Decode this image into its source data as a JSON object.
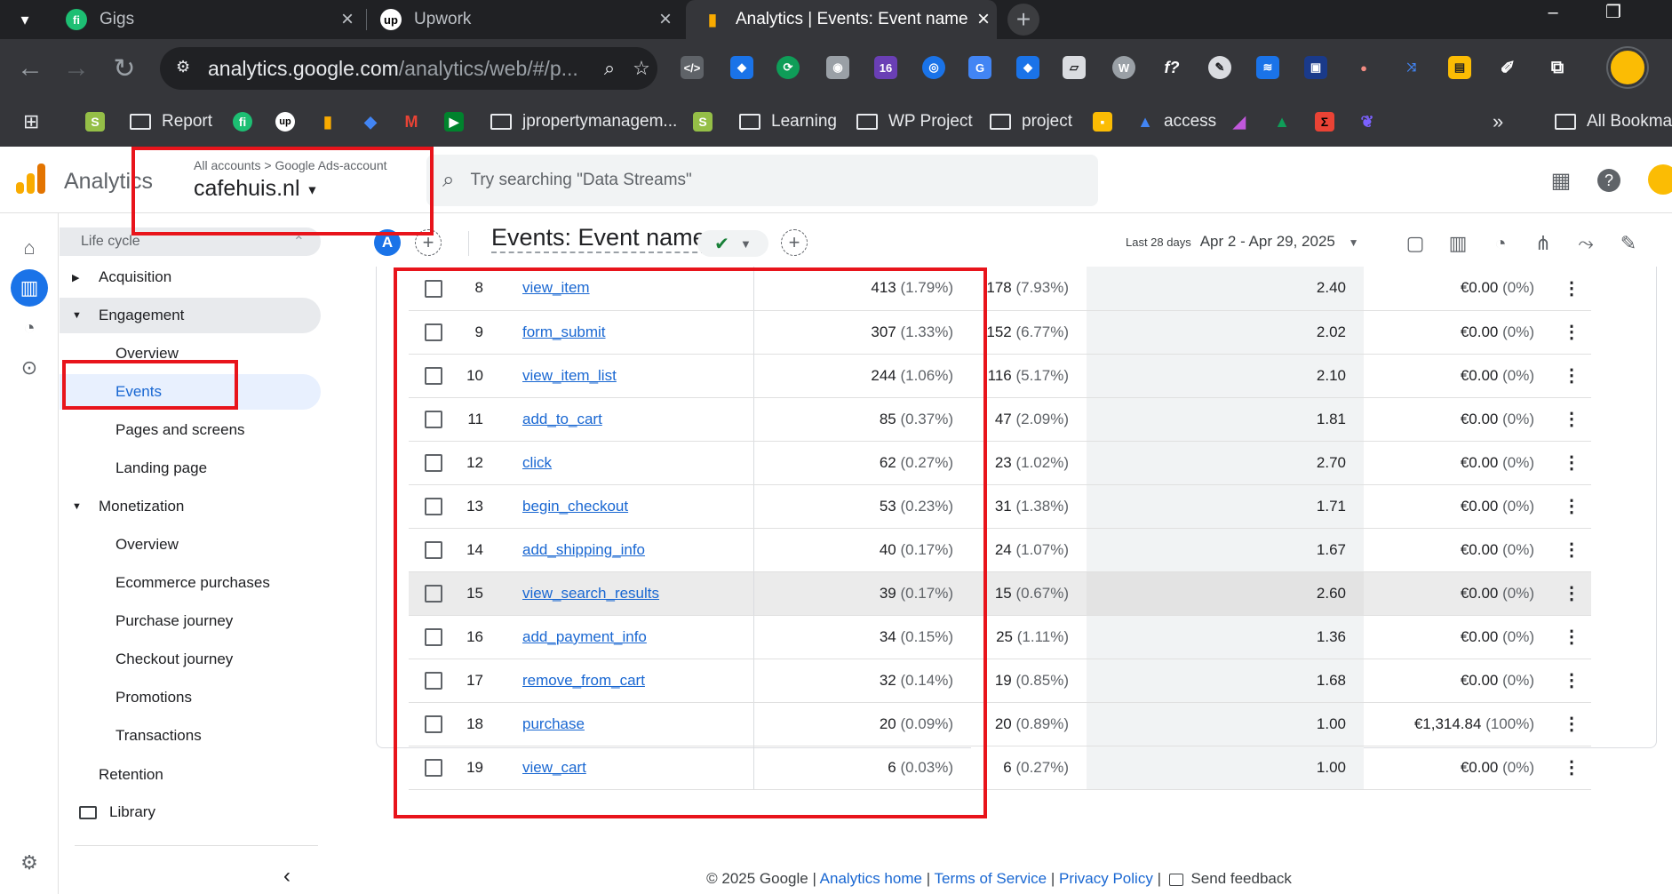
{
  "browser": {
    "tabs": [
      {
        "title": "Gigs",
        "icon": "fiverr-icon"
      },
      {
        "title": "Upwork",
        "icon": "upwork-icon"
      },
      {
        "title": "Analytics | Events: Event name",
        "icon": "google-analytics-icon",
        "active": true
      }
    ],
    "url_host": "analytics.google.com",
    "url_rest": "/analytics/web/#/p...",
    "bookmarks": [
      "Report",
      "jpropertymanagem...",
      "Learning",
      "WP Project",
      "project",
      "access",
      "All Bookmar"
    ],
    "ext_badge": "16"
  },
  "ga": {
    "app_name": "Analytics",
    "breadcrumb": "All accounts > Google Ads-account",
    "property": "cafehuis.nl",
    "search_placeholder": "Try searching \"Data Streams\""
  },
  "nav": {
    "lifecycle": "Life cycle",
    "acquisition": "Acquisition",
    "engagement": "Engagement",
    "eng_overview": "Overview",
    "events": "Events",
    "pages": "Pages and screens",
    "landing": "Landing page",
    "monetization": "Monetization",
    "mon_overview": "Overview",
    "ecommerce": "Ecommerce purchases",
    "purchase_journey": "Purchase journey",
    "checkout_journey": "Checkout journey",
    "promotions": "Promotions",
    "transactions": "Transactions",
    "retention": "Retention",
    "library": "Library"
  },
  "report": {
    "avatar_letter": "A",
    "title": "Events: Event name",
    "date_label": "Last 28 days",
    "date_range": "Apr 2 - Apr 29, 2025"
  },
  "rows": [
    {
      "n": "8",
      "name": "view_item",
      "count": "413",
      "count_pct": "(1.79%)",
      "users": "178",
      "users_pct": "(7.93%)",
      "per_user": "2.40",
      "revenue": "€0.00",
      "rev_pct": "(0%)"
    },
    {
      "n": "9",
      "name": "form_submit",
      "count": "307",
      "count_pct": "(1.33%)",
      "users": "152",
      "users_pct": "(6.77%)",
      "per_user": "2.02",
      "revenue": "€0.00",
      "rev_pct": "(0%)"
    },
    {
      "n": "10",
      "name": "view_item_list",
      "count": "244",
      "count_pct": "(1.06%)",
      "users": "116",
      "users_pct": "(5.17%)",
      "per_user": "2.10",
      "revenue": "€0.00",
      "rev_pct": "(0%)"
    },
    {
      "n": "11",
      "name": "add_to_cart",
      "count": "85",
      "count_pct": "(0.37%)",
      "users": "47",
      "users_pct": "(2.09%)",
      "per_user": "1.81",
      "revenue": "€0.00",
      "rev_pct": "(0%)"
    },
    {
      "n": "12",
      "name": "click",
      "count": "62",
      "count_pct": "(0.27%)",
      "users": "23",
      "users_pct": "(1.02%)",
      "per_user": "2.70",
      "revenue": "€0.00",
      "rev_pct": "(0%)"
    },
    {
      "n": "13",
      "name": "begin_checkout",
      "count": "53",
      "count_pct": "(0.23%)",
      "users": "31",
      "users_pct": "(1.38%)",
      "per_user": "1.71",
      "revenue": "€0.00",
      "rev_pct": "(0%)"
    },
    {
      "n": "14",
      "name": "add_shipping_info",
      "count": "40",
      "count_pct": "(0.17%)",
      "users": "24",
      "users_pct": "(1.07%)",
      "per_user": "1.67",
      "revenue": "€0.00",
      "rev_pct": "(0%)"
    },
    {
      "n": "15",
      "name": "view_search_results",
      "count": "39",
      "count_pct": "(0.17%)",
      "users": "15",
      "users_pct": "(0.67%)",
      "per_user": "2.60",
      "revenue": "€0.00",
      "rev_pct": "(0%)",
      "highlight": true
    },
    {
      "n": "16",
      "name": "add_payment_info",
      "count": "34",
      "count_pct": "(0.15%)",
      "users": "25",
      "users_pct": "(1.11%)",
      "per_user": "1.36",
      "revenue": "€0.00",
      "rev_pct": "(0%)"
    },
    {
      "n": "17",
      "name": "remove_from_cart",
      "count": "32",
      "count_pct": "(0.14%)",
      "users": "19",
      "users_pct": "(0.85%)",
      "per_user": "1.68",
      "revenue": "€0.00",
      "rev_pct": "(0%)"
    },
    {
      "n": "18",
      "name": "purchase",
      "count": "20",
      "count_pct": "(0.09%)",
      "users": "20",
      "users_pct": "(0.89%)",
      "per_user": "1.00",
      "revenue": "€1,314.84",
      "rev_pct": "(100%)"
    },
    {
      "n": "19",
      "name": "view_cart",
      "count": "6",
      "count_pct": "(0.03%)",
      "users": "6",
      "users_pct": "(0.27%)",
      "per_user": "1.00",
      "revenue": "€0.00",
      "rev_pct": "(0%)"
    }
  ],
  "footer": {
    "copyright": "© 2025 Google |",
    "home": "Analytics home",
    "sep1": "|",
    "terms": "Terms of Service",
    "sep2": "|",
    "privacy": "Privacy Policy",
    "sep3": "|",
    "feedback": "Send feedback"
  },
  "colors": {
    "accent": "#1a73e8",
    "annotation": "#e8141b",
    "ga_orange": "#f9ab00"
  }
}
